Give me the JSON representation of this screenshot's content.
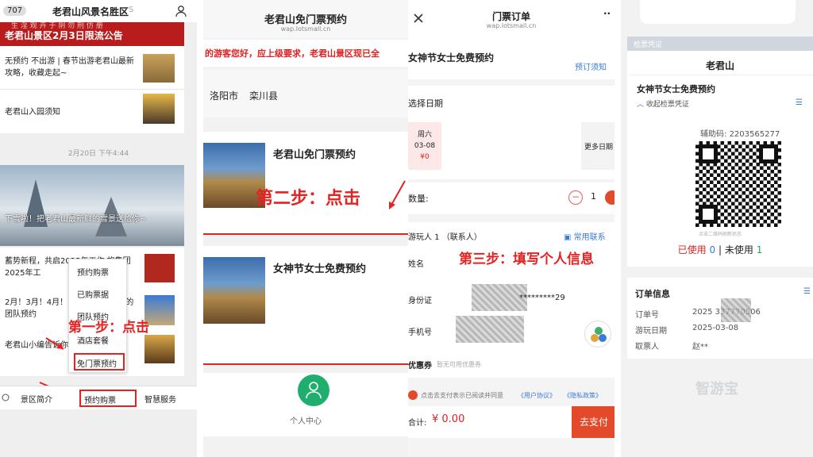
{
  "panel1": {
    "badge": "707",
    "title": "老君山风景名胜区",
    "title_suffix": "S",
    "banner_top": "生 淫 观 卉 于 阴 勿 刑 仿 册",
    "banner": "老君山景区2月3日限流公告",
    "articles": [
      {
        "text": "无预约 不出游 | 春节出游老君山最新攻略，收藏走起~"
      },
      {
        "text": "老君山入园须知"
      }
    ],
    "timestamp": "2月20日 下午4:44",
    "feature_caption": "下雪啦！把老君山最新鲜的雪景送给你~",
    "list": [
      {
        "text": "蓄势新程，共启2025年工作 旅集团2025年工"
      },
      {
        "text": "2月！3月！4月！ 老君山，是这样的 团队预约"
      },
      {
        "text": "老君山小编告诉你 游览老君山！"
      }
    ],
    "popup_menu": [
      "预约购票",
      "已购票据",
      "团队预约",
      "酒店套餐",
      "免门票预约"
    ],
    "bottom_tabs": [
      "景区简介",
      "预约购票",
      "智慧服务"
    ],
    "step_label": "第一步：点击"
  },
  "panel2": {
    "title": "老君山免门票预约",
    "subtitle": "wap.lotsmall.cn",
    "marquee": "的游客您好，应上级要求，老君山景区现已全",
    "location_city": "洛阳市",
    "location_county": "栾川县",
    "cards": [
      {
        "title": "老君山免门票预约"
      },
      {
        "title": "女神节女士免费预约"
      }
    ],
    "step_label": "第二步：点击",
    "user_center": "个人中心"
  },
  "panel3": {
    "close_icon": "close-icon",
    "title": "门票订单",
    "subtitle": "wap.lotsmall.cn",
    "product": "女神节女士免费预约",
    "notice_link": "预订须知",
    "date_section": "选择日期",
    "date_card": {
      "weekday": "周六",
      "date": "03-08",
      "price": "¥0"
    },
    "more_dates": "更多日期",
    "qty_label": "数量:",
    "qty_value": "1",
    "visitor_label": "游玩人 1 （联系人）",
    "contacts_link": "常用联系",
    "step_label": "第三步：填写个人信息",
    "fields": [
      {
        "label": "姓名",
        "value": ""
      },
      {
        "label": "身份证",
        "value": "*********29"
      },
      {
        "label": "手机号",
        "value": ""
      },
      {
        "label": "优惠券",
        "value": "暂无可用优惠券"
      }
    ],
    "agreement_prefix": "点击去支付表示已阅读并同意",
    "agreement_links": [
      "《用户协议》",
      "《隐私政策》"
    ],
    "total_label": "合计:",
    "total_value": "¥ 0.00",
    "pay_button": "去支付"
  },
  "panel4": {
    "section_label": "检票凭证",
    "venue": "老君山",
    "product": "女神节女士免费预约",
    "collapse_label": "收起检票凭证",
    "aux_code_label": "辅助码:",
    "aux_code": "2203565277",
    "qr_hint": "点击二维码刷新状态",
    "used_label": "已使用",
    "used_count": "0",
    "unused_label": "未使用",
    "unused_count": "1",
    "order_title": "订单信息",
    "order_rows": [
      {
        "label": "订单号",
        "value": "2025 337770506"
      },
      {
        "label": "游玩日期",
        "value": "2025-03-08"
      },
      {
        "label": "取票人",
        "value": "赵**"
      }
    ],
    "brand": "智游宝"
  }
}
